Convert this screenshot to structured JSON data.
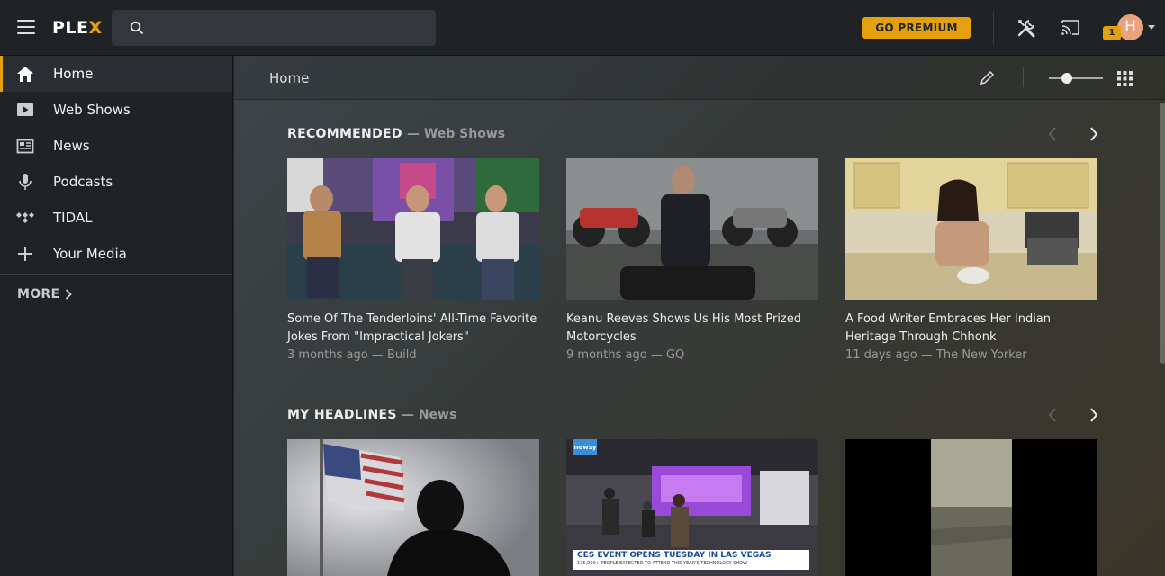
{
  "header": {
    "logo": {
      "main": "PLE",
      "accent": "X"
    },
    "search_placeholder": "",
    "premium_label": "GO PREMIUM",
    "notification_count": "1",
    "avatar_initial": "H"
  },
  "sidebar": {
    "items": [
      {
        "label": "Home",
        "icon": "home-icon",
        "active": true
      },
      {
        "label": "Web Shows",
        "icon": "play-icon"
      },
      {
        "label": "News",
        "icon": "news-icon"
      },
      {
        "label": "Podcasts",
        "icon": "microphone-icon"
      },
      {
        "label": "TIDAL",
        "icon": "tidal-icon"
      },
      {
        "label": "Your Media",
        "icon": "plus-icon"
      }
    ],
    "more_label": "MORE"
  },
  "main": {
    "breadcrumb": "Home",
    "sections": [
      {
        "title": "RECOMMENDED",
        "subtitle": "— Web Shows",
        "cards": [
          {
            "title": "Some Of The Tenderloins' All-Time Favorite Jokes From \"Impractical Jokers\"",
            "meta": "3 months ago — Build"
          },
          {
            "title": "Keanu Reeves Shows Us His Most Prized Motorcycles",
            "meta": "9 months ago — GQ"
          },
          {
            "title": "A Food Writer Embraces Her Indian Heritage Through Chhonk",
            "meta": "11 days ago — The New Yorker"
          }
        ]
      },
      {
        "title": "MY HEADLINES",
        "subtitle": "— News",
        "cards": [
          {
            "caption": "CES EVENT OPENS TUESDAY IN LAS VEGAS",
            "caption_sub": "175,000+ PEOPLE EXPECTED TO ATTEND THIS YEAR'S TECHNOLOGY SHOW",
            "brand": "newsy"
          }
        ]
      }
    ]
  },
  "colors": {
    "accent": "#e5a00d",
    "background": "#1f2326"
  }
}
